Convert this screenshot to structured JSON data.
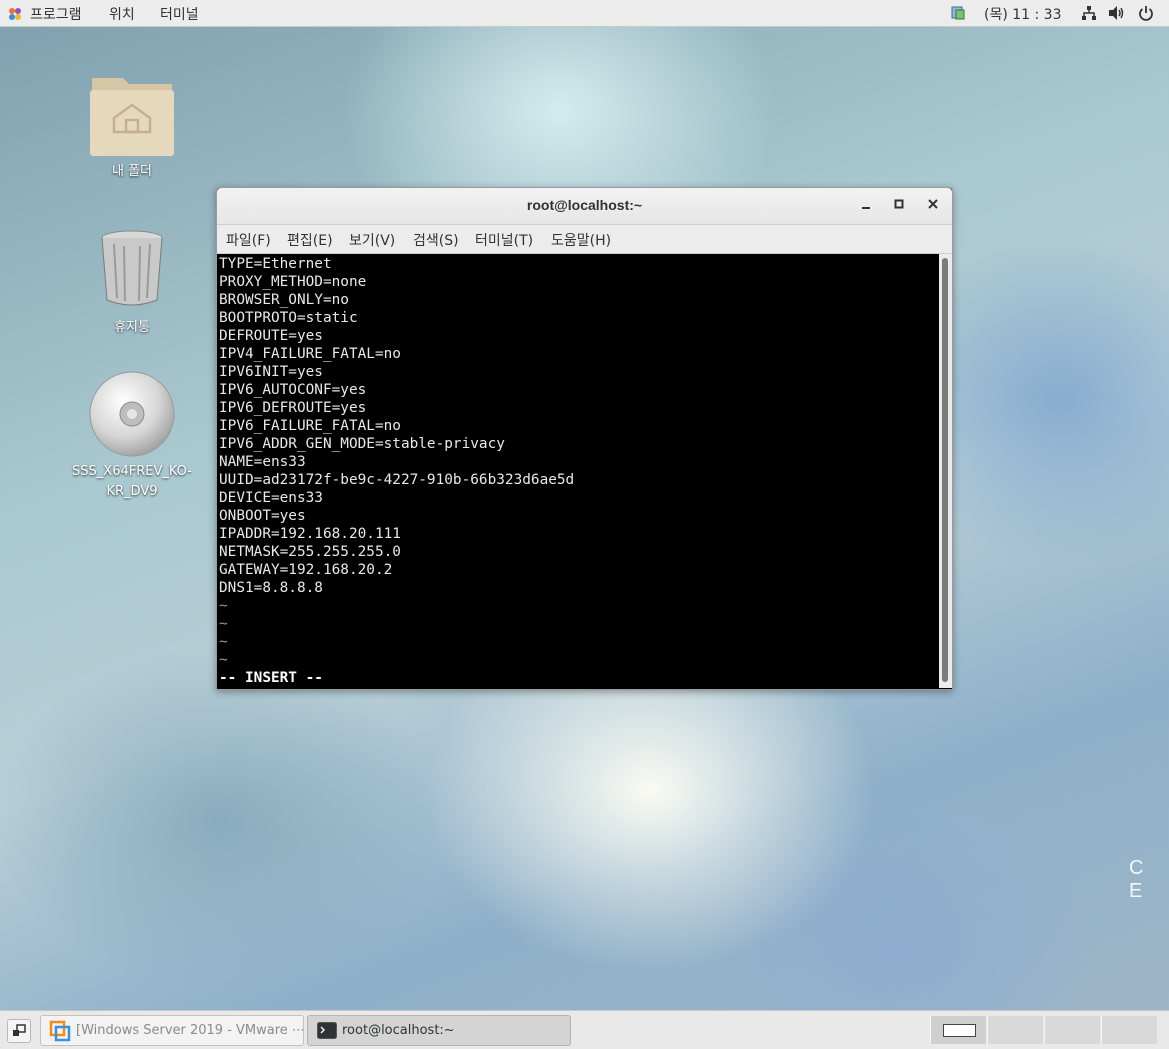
{
  "topbar": {
    "menus": [
      "프로그램",
      "위치",
      "터미널"
    ],
    "clock": "(목) 11 : 33",
    "icons": [
      "applications-icon",
      "update-icon",
      "network-icon",
      "volume-icon",
      "power-icon"
    ]
  },
  "desktop": {
    "icons": [
      {
        "label": "내 폴더",
        "icon": "home-folder-icon"
      },
      {
        "label": "휴지통",
        "icon": "trash-icon"
      },
      {
        "label_line1": "SSS_X64FREV_KO-",
        "label_line2": "KR_DV9",
        "icon": "dvd-icon"
      }
    ],
    "watermark": "C E"
  },
  "terminal": {
    "title": "root@localhost:~",
    "menus": [
      "파일(F)",
      "편집(E)",
      "보기(V)",
      "검색(S)",
      "터미널(T)",
      "도움말(H)"
    ],
    "lines": [
      "TYPE=Ethernet",
      "PROXY_METHOD=none",
      "BROWSER_ONLY=no",
      "BOOTPROTO=static",
      "DEFROUTE=yes",
      "IPV4_FAILURE_FATAL=no",
      "IPV6INIT=yes",
      "IPV6_AUTOCONF=yes",
      "IPV6_DEFROUTE=yes",
      "IPV6_FAILURE_FATAL=no",
      "IPV6_ADDR_GEN_MODE=stable-privacy",
      "NAME=ens33",
      "UUID=ad23172f-be9c-4227-910b-66b323d6ae5d",
      "DEVICE=ens33",
      "ONBOOT=yes",
      "IPADDR=192.168.20.111",
      "NETMASK=255.255.255.0",
      "GATEWAY=192.168.20.2",
      "DNS1=8.8.8.8"
    ],
    "tildes": [
      "~",
      "~",
      "~",
      "~"
    ],
    "mode_line": "-- INSERT --"
  },
  "taskbar": {
    "tasks": [
      {
        "label": "[Windows Server 2019 - VMware ⋯",
        "icon": "vmware-icon"
      },
      {
        "label": "root@localhost:~",
        "icon": "terminal-icon"
      }
    ]
  },
  "colors": {
    "terminal_bg": "#000000",
    "terminal_fg": "#e8e8e8",
    "panel_bg": "#ececec"
  }
}
